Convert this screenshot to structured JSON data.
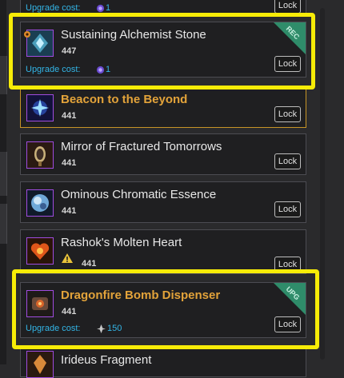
{
  "colors": {
    "legendary": "#e3a33a",
    "link": "#33b5e6",
    "highlight": "#f7ec07",
    "ribbon": "#2f8c6a"
  },
  "top_partial": {
    "upgrade_label": "Upgrade cost:",
    "upgrade_value": "1",
    "lock_label": "Lock"
  },
  "items": [
    {
      "name": "Sustaining Alchemist Stone",
      "ilvl": "447",
      "upgrade_label": "Upgrade cost:",
      "upgrade_value": "1",
      "lock_label": "Lock",
      "ribbon": "REC",
      "icon": "alchemist-stone-icon"
    },
    {
      "name": "Beacon to the Beyond",
      "ilvl": "441",
      "lock_label": "Lock",
      "icon": "beacon-icon"
    },
    {
      "name": "Mirror of Fractured Tomorrows",
      "ilvl": "441",
      "lock_label": "Lock",
      "icon": "mirror-icon"
    },
    {
      "name": "Ominous Chromatic Essence",
      "ilvl": "441",
      "lock_label": "Lock",
      "icon": "chromatic-essence-icon"
    },
    {
      "name": "Rashok's Molten Heart",
      "ilvl": "441",
      "lock_label": "Lock",
      "icon": "molten-heart-icon",
      "warning_icon": "warning-icon"
    },
    {
      "name": "Dragonfire Bomb Dispenser",
      "ilvl": "441",
      "upgrade_label": "Upgrade cost:",
      "upgrade_value": "150",
      "lock_label": "Lock",
      "ribbon": "UPG",
      "icon": "bomb-dispenser-icon"
    },
    {
      "name": "Irideus Fragment",
      "icon": "irideus-fragment-icon"
    }
  ]
}
